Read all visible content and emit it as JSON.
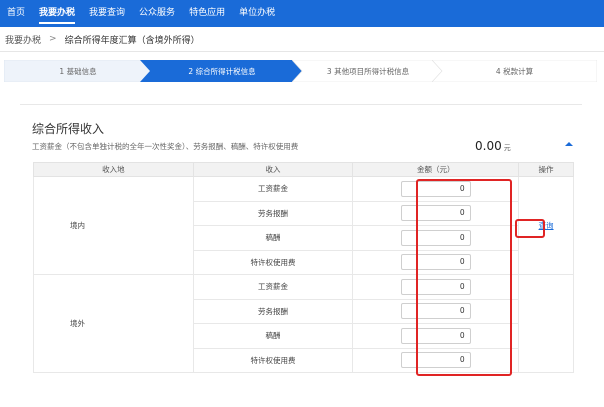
{
  "nav": {
    "items": [
      "首页",
      "我要办税",
      "我要查询",
      "公众服务",
      "特色应用",
      "单位办税"
    ],
    "active_index": 1
  },
  "breadcrumb": {
    "root": "我要办税",
    "separator": ">",
    "current": "综合所得年度汇算（含境外所得）"
  },
  "steps": [
    "1 基础信息",
    "2 综合所得计税信息",
    "3 其他项目所得计税信息",
    "4 税款计算"
  ],
  "active_step": 2,
  "section": {
    "title": "综合所得收入",
    "description": "工资薪金（不包含单独计税的全年一次性奖金）、劳务报酬、稿酬、特许权使用费",
    "total_value": "0.00",
    "total_unit": "元"
  },
  "table": {
    "headers": [
      "收入地",
      "收入",
      "金额（元）",
      "操作"
    ],
    "groups": [
      {
        "region": "境内",
        "rows": [
          {
            "income": "工资薪金",
            "amount": "0"
          },
          {
            "income": "劳务报酬",
            "amount": "0"
          },
          {
            "income": "稿酬",
            "amount": "0"
          },
          {
            "income": "特许权使用费",
            "amount": "0"
          }
        ],
        "action": "查询"
      },
      {
        "region": "境外",
        "rows": [
          {
            "income": "工资薪金",
            "amount": "0"
          },
          {
            "income": "劳务报酬",
            "amount": "0"
          },
          {
            "income": "稿酬",
            "amount": "0"
          },
          {
            "income": "特许权使用费",
            "amount": "0"
          }
        ],
        "action": ""
      }
    ]
  },
  "colors": {
    "brand": "#1a6bd8",
    "highlight": "#e02424"
  }
}
